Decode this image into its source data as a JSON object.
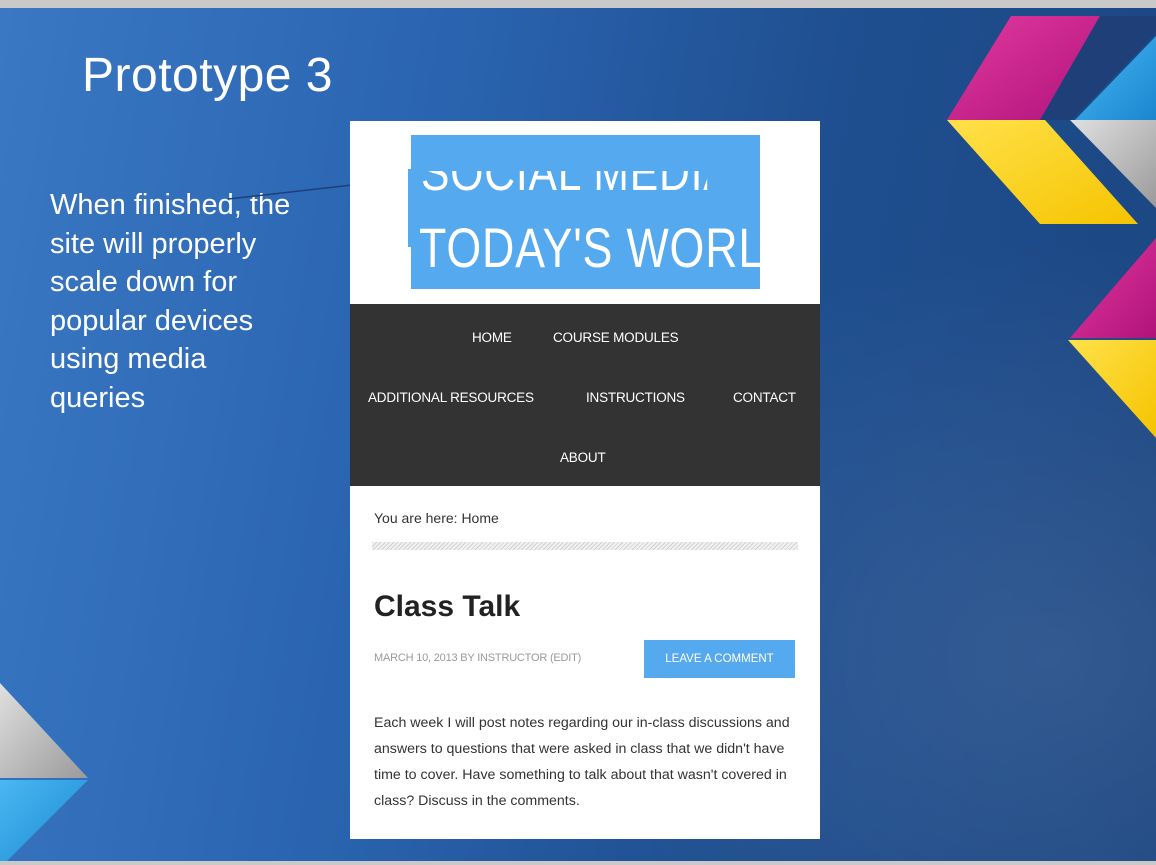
{
  "slide": {
    "title": "Prototype 3",
    "body": "When finished, the site will properly scale down for popular devices using media queries"
  },
  "site": {
    "logo_line1": "SOCIAL MEDIA IN",
    "logo_line2": "TODAY'S WORLD",
    "nav": {
      "items": [
        {
          "label": "HOME"
        },
        {
          "label": "COURSE MODULES"
        },
        {
          "label": "ADDITIONAL RESOURCES"
        },
        {
          "label": "INSTRUCTIONS"
        },
        {
          "label": "CONTACT"
        },
        {
          "label": "ABOUT"
        }
      ]
    },
    "breadcrumb": "You are here: Home",
    "post": {
      "title": "Class Talk",
      "meta": "MARCH 10, 2013 BY INSTRUCTOR (EDIT)",
      "comment_button": "LEAVE A COMMENT",
      "body": "Each week I will post notes regarding our in-class discussions and answers to questions that were asked in class that we didn't have time to cover. Have something to talk about that wasn't covered in class? Discuss in the comments."
    }
  },
  "colors": {
    "slide_blue": "#2a64b0",
    "site_accent": "#55a9ef",
    "nav_background": "#333333",
    "deco_magenta": "#d8208f",
    "deco_yellow": "#ffd200",
    "deco_cyan": "#1ea0e6",
    "deco_gray": "#b5b5b5"
  }
}
